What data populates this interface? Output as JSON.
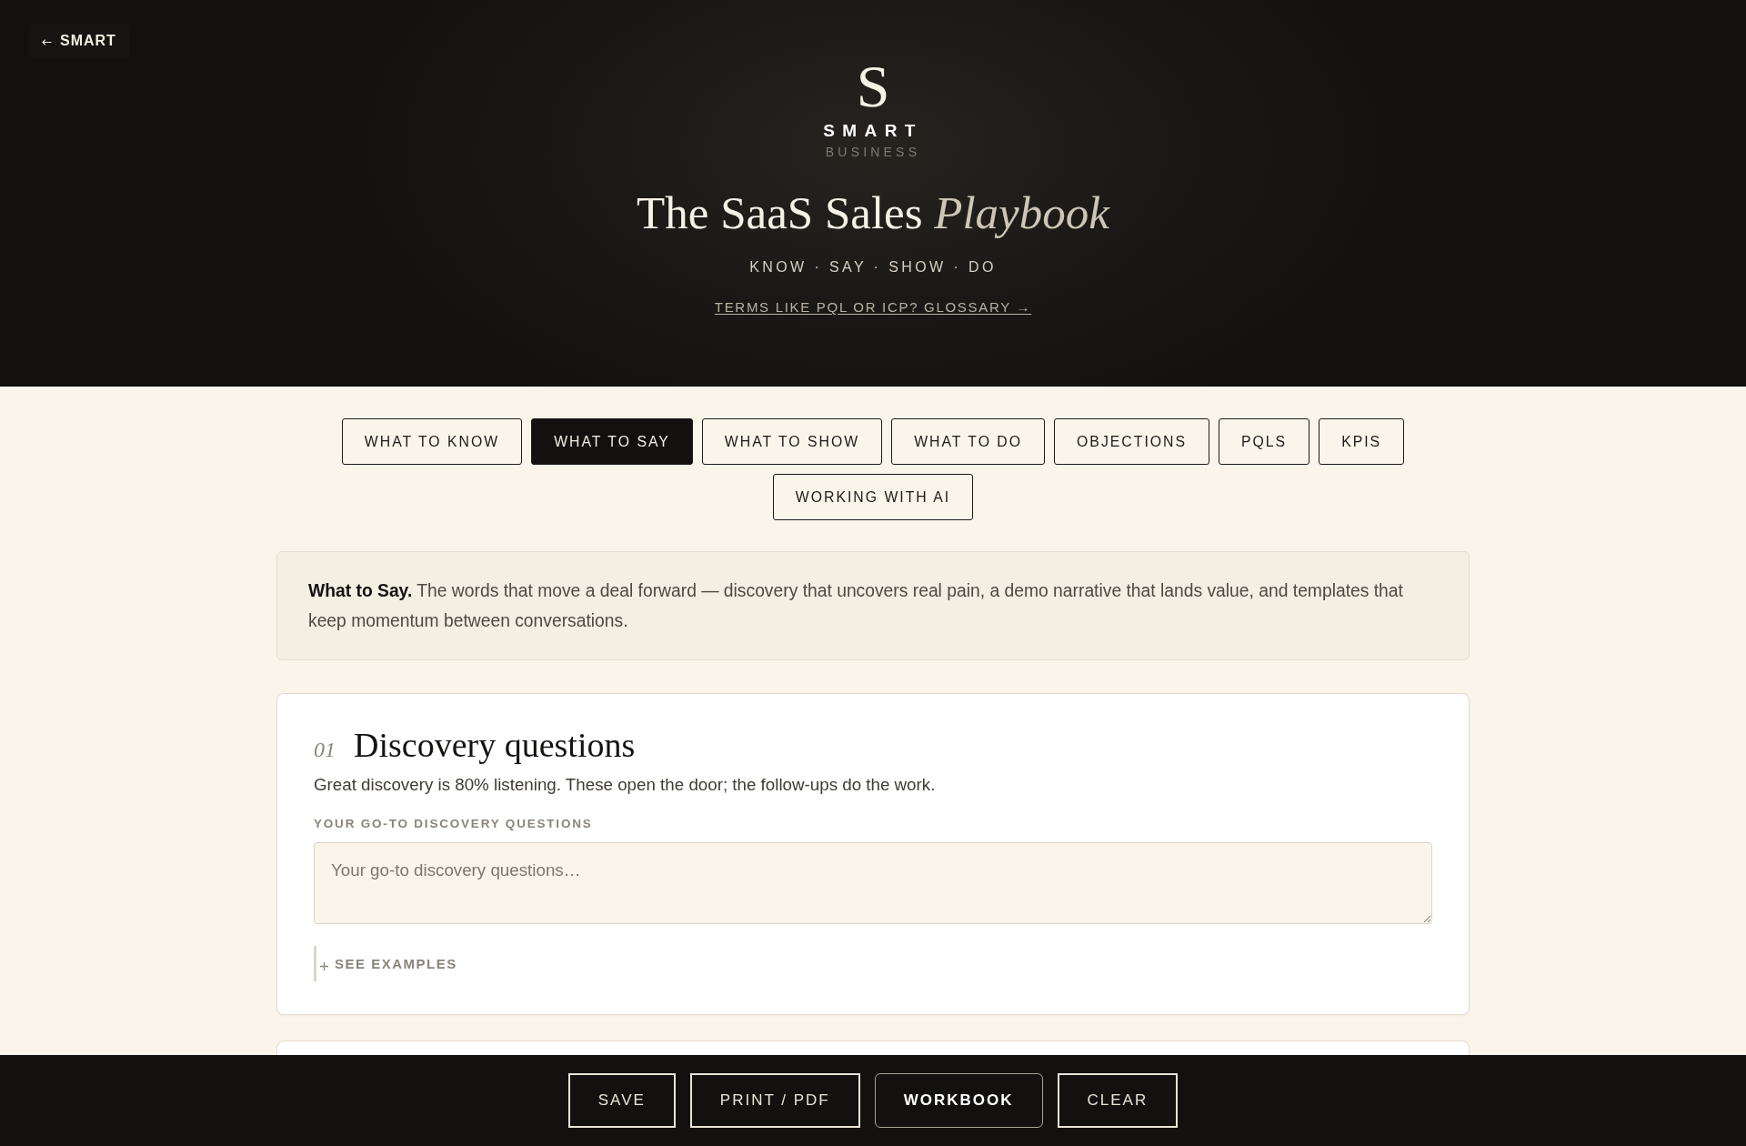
{
  "back_link": {
    "label": "SMART"
  },
  "brand": {
    "mark": "S",
    "name": "SMART",
    "tagline": "BUSINESS"
  },
  "hero": {
    "title": "The SaaS Sales *Playbook*",
    "subtitle": "KNOW · SAY · SHOW · DO",
    "glossary_link": "TERMS LIKE PQL OR ICP? GLOSSARY →"
  },
  "tabs": [
    {
      "label": "WHAT TO KNOW",
      "selected": false
    },
    {
      "label": "WHAT TO SAY",
      "selected": true
    },
    {
      "label": "WHAT TO SHOW",
      "selected": false
    },
    {
      "label": "WHAT TO DO",
      "selected": false
    },
    {
      "label": "OBJECTIONS",
      "selected": false
    },
    {
      "label": "PQLS",
      "selected": false
    },
    {
      "label": "KPIS",
      "selected": false
    },
    {
      "label": "WORKING WITH AI",
      "selected": false
    }
  ],
  "intro": {
    "text": "**What to Say.** The words that move a deal forward — discovery that uncovers real pain, a demo narrative that lands value, and templates that keep momentum between conversations."
  },
  "sections": [
    {
      "number": "01",
      "title": "Discovery questions",
      "description": "Great discovery is 80% listening. These open the door; the follow-ups do the work.",
      "field": {
        "label": "YOUR GO-TO DISCOVERY QUESTIONS",
        "placeholder": "Your go-to discovery questions…"
      },
      "examples_toggle": {
        "label": "SEE EXAMPLES",
        "expanded": false
      }
    }
  ],
  "actions": [
    {
      "label": "SAVE",
      "kind": "outline"
    },
    {
      "label": "PRINT / PDF",
      "kind": "outline"
    },
    {
      "label": "WORKBOOK",
      "kind": "primary"
    },
    {
      "label": "CLEAR",
      "kind": "outline"
    }
  ]
}
